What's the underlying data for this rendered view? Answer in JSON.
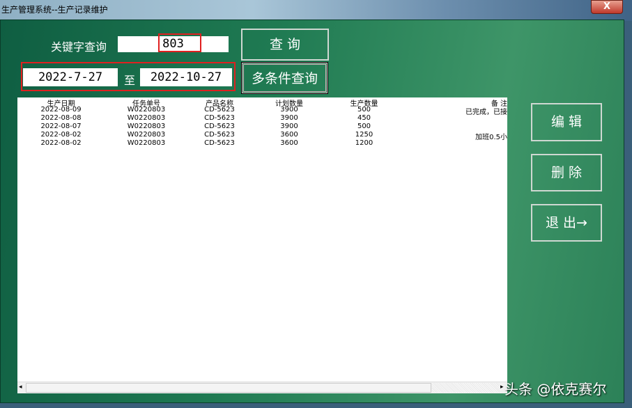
{
  "window": {
    "title": "生产管理系统--生产记录维护",
    "close_label": "X"
  },
  "search": {
    "keyword_label": "关键字查询",
    "keyword_value": "803",
    "query_button": "查 询",
    "date_from": "2022-7-27",
    "date_sep": "至",
    "date_to": "2022-10-27",
    "multi_query_button": "多条件查询"
  },
  "table": {
    "headers": [
      "生产日期",
      "任务单号",
      "产品名称",
      "计划数量",
      "生产数量",
      "备 注"
    ],
    "rows": [
      [
        "2022-08-09",
        "W0220803",
        "CD-5623",
        "3900",
        "500",
        "已完成，已接"
      ],
      [
        "2022-08-08",
        "W0220803",
        "CD-5623",
        "3900",
        "450",
        ""
      ],
      [
        "2022-08-07",
        "W0220803",
        "CD-5623",
        "3900",
        "500",
        ""
      ],
      [
        "2022-08-02",
        "W0220803",
        "CD-5623",
        "3600",
        "1250",
        "加班0.5小"
      ],
      [
        "2022-08-02",
        "W0220803",
        "CD-5623",
        "3600",
        "1200",
        ""
      ]
    ]
  },
  "actions": {
    "edit": "编 辑",
    "delete": "删 除",
    "exit": "退 出→"
  },
  "watermark": "头条 @依克赛尔"
}
